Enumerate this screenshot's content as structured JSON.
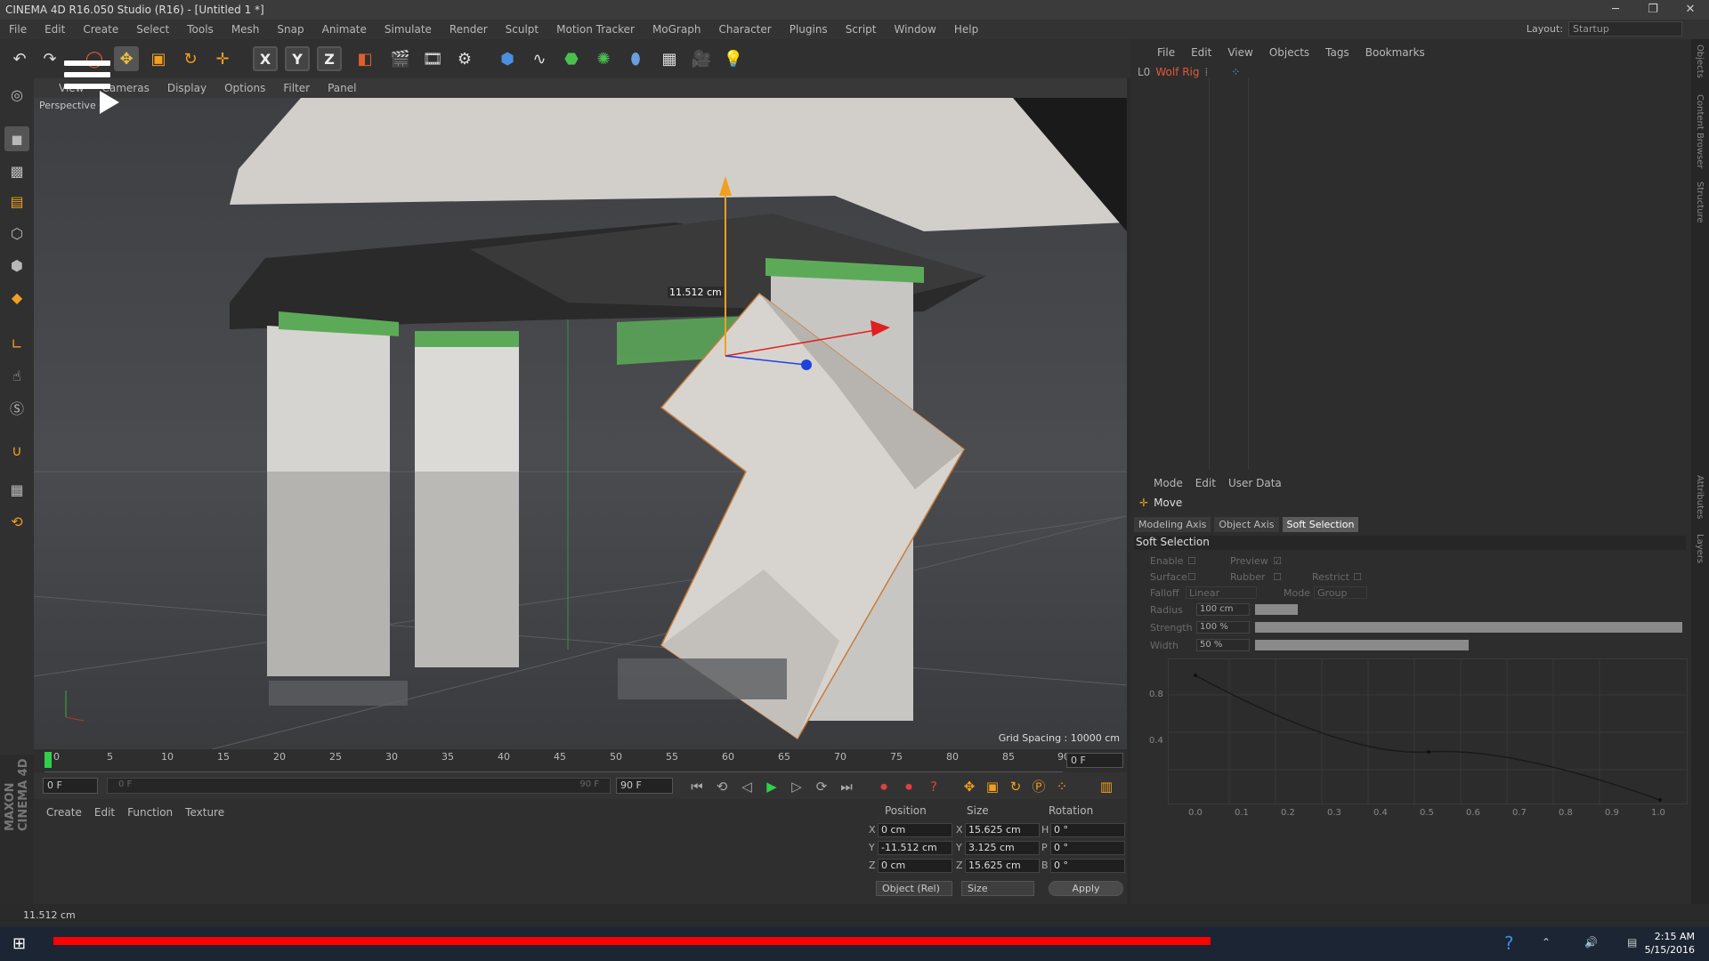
{
  "window": {
    "title": "CINEMA 4D R16.050 Studio (R16) - [Untitled 1 *]"
  },
  "menubar": {
    "items": [
      "File",
      "Edit",
      "Create",
      "Select",
      "Tools",
      "Mesh",
      "Snap",
      "Animate",
      "Simulate",
      "Render",
      "Sculpt",
      "Motion Tracker",
      "MoGraph",
      "Character",
      "Plugins",
      "Script",
      "Window",
      "Help"
    ],
    "layout_label": "Layout:",
    "layout_value": "Startup"
  },
  "toolbar": {
    "x_label": "X",
    "y_label": "Y",
    "z_label": "Z"
  },
  "viewport": {
    "menu": [
      "View",
      "Cameras",
      "Display",
      "Options",
      "Filter",
      "Panel"
    ],
    "camera_label": "Perspective",
    "measure": "11.512 cm",
    "grid_spacing": "Grid Spacing : 10000 cm"
  },
  "timeline": {
    "ticks": [
      "0",
      "5",
      "10",
      "15",
      "20",
      "25",
      "30",
      "35",
      "40",
      "45",
      "50",
      "55",
      "60",
      "65",
      "70",
      "75",
      "80",
      "85",
      "90"
    ],
    "current_frame": "0 F"
  },
  "playback": {
    "start_frame": "0 F",
    "min_frame": "0 F",
    "max_frame_slider": "90 F",
    "end_frame": "90 F"
  },
  "material_manager": {
    "menu": [
      "Create",
      "Edit",
      "Function",
      "Texture"
    ]
  },
  "coords": {
    "headers": {
      "position": "Position",
      "size": "Size",
      "rotation": "Rotation"
    },
    "rows": [
      {
        "axis": "X",
        "pos": "0 cm",
        "size_axis": "X",
        "size": "15.625 cm",
        "rot_axis": "H",
        "rot": "0 °"
      },
      {
        "axis": "Y",
        "pos": "-11.512 cm",
        "size_axis": "Y",
        "size": "3.125 cm",
        "rot_axis": "P",
        "rot": "0 °"
      },
      {
        "axis": "Z",
        "pos": "0 cm",
        "size_axis": "Z",
        "size": "15.625 cm",
        "rot_axis": "B",
        "rot": "0 °"
      }
    ],
    "mode_dropdown": "Object (Rel)",
    "size_dropdown": "Size",
    "apply_label": "Apply"
  },
  "status_text": "11.512 cm",
  "object_manager": {
    "menu": [
      "File",
      "Edit",
      "View",
      "Objects",
      "Tags",
      "Bookmarks"
    ],
    "object_name": "Wolf Rig"
  },
  "attribute_manager": {
    "menu": [
      "Mode",
      "Edit",
      "User Data"
    ],
    "tool_name": "Move",
    "tabs": [
      "Modeling Axis",
      "Object Axis",
      "Soft Selection"
    ],
    "active_tab": "Soft Selection",
    "section": "Soft Selection",
    "params": {
      "enable": "Enable",
      "preview": "Preview",
      "surface": "Surface",
      "rubber": "Rubber",
      "restrict": "Restrict",
      "falloff": "Falloff",
      "falloff_value": "Linear",
      "mode": "Mode",
      "mode_value": "Group",
      "radius_label": "Radius",
      "radius": "100 cm",
      "radius_fraction": 0.1,
      "strength_label": "Strength",
      "strength": "100 %",
      "strength_fraction": 1.0,
      "width_label": "Width",
      "width": "50 %",
      "width_fraction": 0.5
    },
    "graph": {
      "x_ticks": [
        "0.0",
        "0.1",
        "0.2",
        "0.3",
        "0.4",
        "0.5",
        "0.6",
        "0.7",
        "0.8",
        "0.9",
        "1.0"
      ],
      "y_ticks": [
        "0.8",
        "0.4"
      ]
    }
  },
  "right_tabs": [
    "Objects",
    "Content Browser",
    "Structure",
    "Attributes",
    "Layers"
  ],
  "brand": "MAXON CINEMA 4D",
  "taskbar": {
    "time": "2:15 AM",
    "date": "5/15/2016"
  }
}
